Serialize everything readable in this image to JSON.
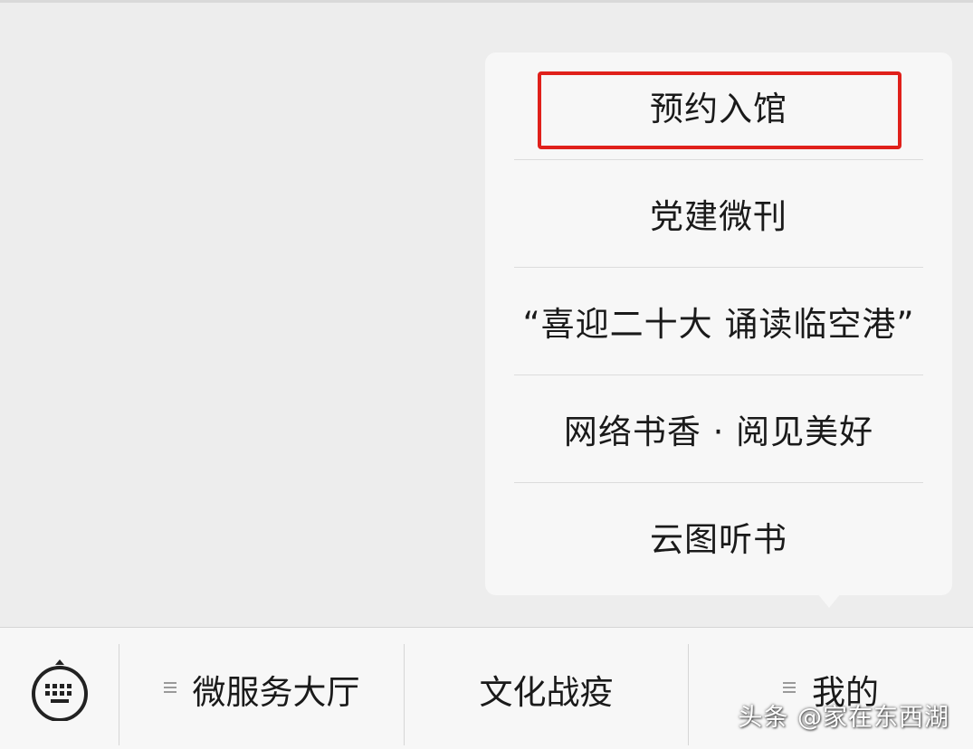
{
  "popup_menu": {
    "items": [
      {
        "label": "预约入馆",
        "highlighted": true
      },
      {
        "label": "党建微刊"
      },
      {
        "label": "“喜迎二十大 诵读临空港”"
      },
      {
        "label": "网络书香 · 阅见美好"
      },
      {
        "label": "云图听书"
      }
    ],
    "highlight_color": "#e0201b"
  },
  "bottom_bar": {
    "keyboard_icon": "keyboard-icon",
    "menus": [
      {
        "label": "微服务大厅",
        "has_submenu_icon": true
      },
      {
        "label": "文化战疫",
        "has_submenu_icon": false
      },
      {
        "label": "我的",
        "has_submenu_icon": true
      }
    ]
  },
  "watermark": {
    "text": "头条 @家在东西湖"
  }
}
